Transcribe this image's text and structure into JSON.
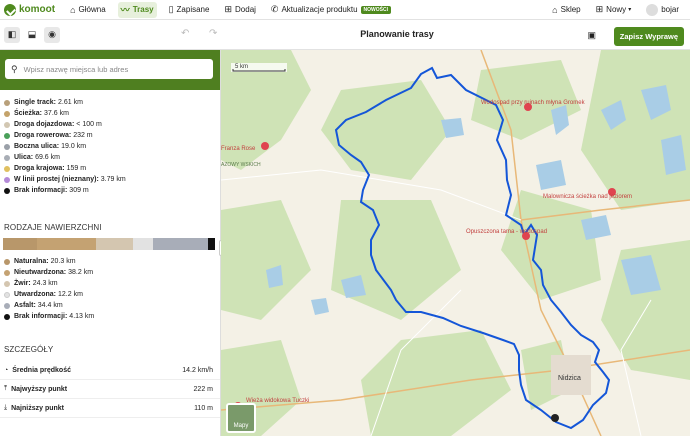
{
  "topnav": {
    "logo": "komoot",
    "items": [
      {
        "label": "Główna",
        "icon": "home-icon"
      },
      {
        "label": "Trasy",
        "icon": "route-icon",
        "active": true
      },
      {
        "label": "Zapisane",
        "icon": "bookmark-icon"
      },
      {
        "label": "Dodaj",
        "icon": "plus-icon"
      },
      {
        "label": "Aktualizacje produktu",
        "icon": "megaphone-icon"
      }
    ],
    "badge": "NOWOŚCI",
    "shop": "Sklep",
    "new": "Nowy",
    "user": "bojar"
  },
  "toolbar": {
    "title": "Planowanie trasy",
    "save": "Zapisz Wyprawę"
  },
  "search": {
    "placeholder": "Wpisz nazwę miejsca lub adres"
  },
  "way_types": [
    {
      "label": "Single track:",
      "value": "2.61 km",
      "color": "#b8a07a"
    },
    {
      "label": "Ścieżka:",
      "value": "37.6 km",
      "color": "#c4a36a"
    },
    {
      "label": "Droga dojazdowa:",
      "value": "< 100 m",
      "color": "#d2c7b2"
    },
    {
      "label": "Droga rowerowa:",
      "value": "232 m",
      "color": "#4aa05a"
    },
    {
      "label": "Boczna ulica:",
      "value": "19.0 km",
      "color": "#9aa0a8"
    },
    {
      "label": "Ulica:",
      "value": "69.6 km",
      "color": "#a8adb5"
    },
    {
      "label": "Droga krajowa:",
      "value": "159 m",
      "color": "#e0c060"
    },
    {
      "label": "W linii prostej (nieznany):",
      "value": "3.79 km",
      "color": "#b48ad8"
    },
    {
      "label": "Brak informacji:",
      "value": "309 m",
      "color": "#111111"
    }
  ],
  "surface_heading": "RODZAJE NAWIERZCHNI",
  "surfaces": [
    {
      "label": "Naturalna:",
      "value": "20.3 km",
      "color": "#b8976a",
      "share": 0.15
    },
    {
      "label": "Nieutwardzona:",
      "value": "38.2 km",
      "color": "#c4a272",
      "share": 0.29
    },
    {
      "label": "Żwir:",
      "value": "24.3 km",
      "color": "#d4c6b0",
      "share": 0.18
    },
    {
      "label": "Utwardzona:",
      "value": "12.2 km",
      "color": "#e2e2e2",
      "share": 0.09
    },
    {
      "label": "Asfalt:",
      "value": "34.4 km",
      "color": "#a8adb8",
      "share": 0.26
    },
    {
      "label": "Brak informacji:",
      "value": "4.13 km",
      "color": "#111111",
      "share": 0.03
    }
  ],
  "details_heading": "SZCZEGÓŁY",
  "details": [
    {
      "label": "Średnia prędkość",
      "value": "14.2 km/h",
      "icon": "speed-icon"
    },
    {
      "label": "Najwyższy punkt",
      "value": "222 m",
      "icon": "highest-point-icon"
    },
    {
      "label": "Najniższy punkt",
      "value": "110 m",
      "icon": "lowest-point-icon"
    }
  ],
  "map": {
    "scale": "5 km",
    "labels": [
      "Wodospad przy ruinach młyna Gromek",
      "Malownicza ścieżka nad jeziorem",
      "Opuszczona tama - wodospad",
      "Nidzica",
      "Wieża widokowa Tuczki",
      "Franza Rose",
      "AZOWY WSKICH"
    ],
    "layers_button": "Mapy"
  }
}
